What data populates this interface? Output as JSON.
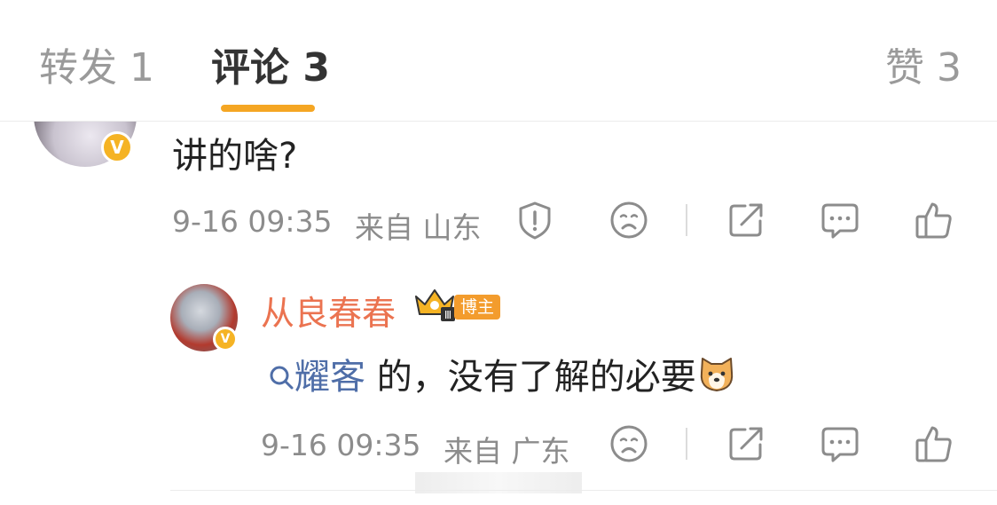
{
  "tabs": [
    {
      "label": "转发 1",
      "active": false
    },
    {
      "label": "评论 3",
      "active": true
    },
    {
      "label": "赞 3",
      "active": false
    }
  ],
  "colors": {
    "accent": "#f5a623",
    "username": "#eb7350",
    "topic": "#4f6ea8",
    "verified": "#f5b324"
  },
  "comments": [
    {
      "text": "讲的啥?",
      "time": "9-16 09:35",
      "source": "来自 山东",
      "icons": [
        "report-icon",
        "dislike-icon",
        "share-icon",
        "comment-icon",
        "like-icon"
      ]
    }
  ],
  "reply": {
    "username": "从良春春",
    "crown_level": "Ⅲ",
    "role_badge": "博主",
    "topic": "耀客",
    "text": " 的，没有了解的必要",
    "time": "9-16 09:35",
    "source": "来自 广东",
    "icons": [
      "dislike-icon",
      "share-icon",
      "comment-icon",
      "like-icon"
    ]
  }
}
